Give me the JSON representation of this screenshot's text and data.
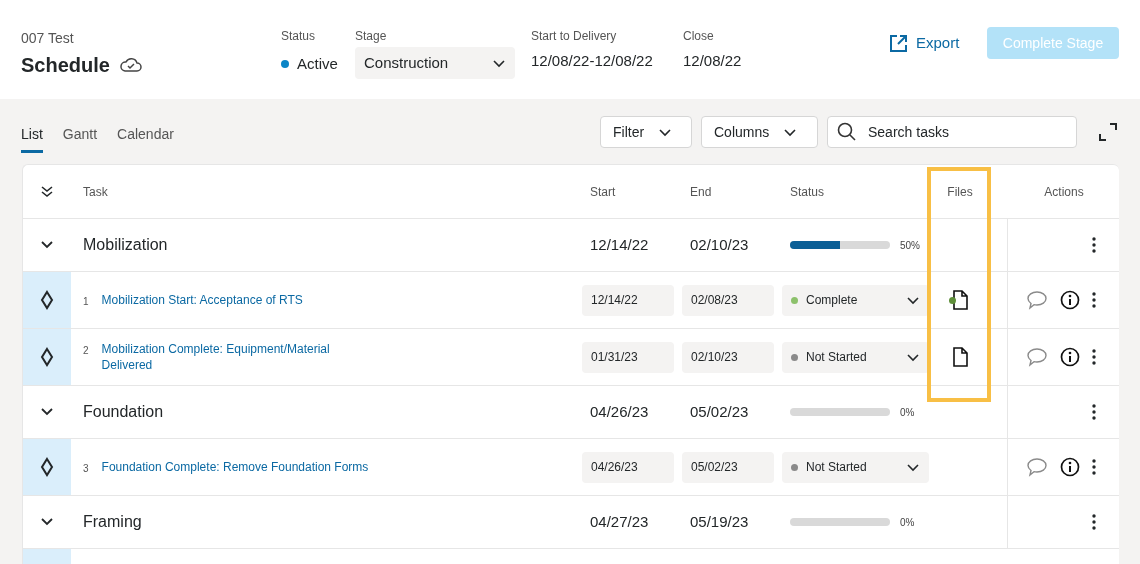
{
  "header": {
    "project": "007 Test",
    "title": "Schedule",
    "status_label": "Status",
    "status": "Active",
    "color": "#0b85c6",
    "stage_label": "Stage",
    "stage": "Construction",
    "delivery_label": "Start to Delivery",
    "delivery": "12/08/22-12/08/22",
    "close_label": "Close",
    "close": "12/08/22",
    "export": "Export",
    "complete_button": {
      "label": "Complete Stage",
      "disabled": true
    }
  },
  "view_tabs": [
    {
      "label": "List",
      "selected": true
    },
    {
      "label": "Gantt",
      "selected": false
    },
    {
      "label": "Calendar",
      "selected": false
    }
  ],
  "toolbar": {
    "filter": "Filter",
    "columns": "Columns",
    "search": {
      "placeholder": "Search tasks"
    }
  },
  "table": {
    "columns": {
      "task": "Task",
      "start": "Start",
      "end": "End",
      "status": "Status",
      "files": "Files",
      "actions": "Actions"
    },
    "groups": [
      {
        "name": "Mobilization",
        "expanded": true,
        "start": "12/14/22",
        "end": "02/10/23",
        "level": 0.5,
        "percent": "50%",
        "tasks": [
          {
            "number": "1",
            "name": "Mobilization Start: Acceptance of RTS",
            "start": "12/14/22",
            "end": "02/08/23",
            "status": "Complete",
            "color": "#8cc16b",
            "has_file": true,
            "file_flag": true
          },
          {
            "number": "2",
            "name": "Mobilization Complete: Equipment/Material Delivered",
            "start": "01/31/23",
            "end": "02/10/23",
            "status": "Not Started",
            "color": "#8a8a8a",
            "has_file": true,
            "file_flag": false
          }
        ]
      },
      {
        "name": "Foundation",
        "expanded": true,
        "start": "04/26/23",
        "end": "05/02/23",
        "level": 0,
        "percent": "0%",
        "tasks": [
          {
            "number": "3",
            "name": "Foundation Complete: Remove Foundation Forms",
            "start": "04/26/23",
            "end": "05/02/23",
            "status": "Not Started",
            "color": "#8a8a8a",
            "has_file": false
          }
        ]
      },
      {
        "name": "Framing",
        "expanded": true,
        "start": "04/27/23",
        "end": "05/19/23",
        "level": 0,
        "percent": "0%"
      }
    ]
  }
}
